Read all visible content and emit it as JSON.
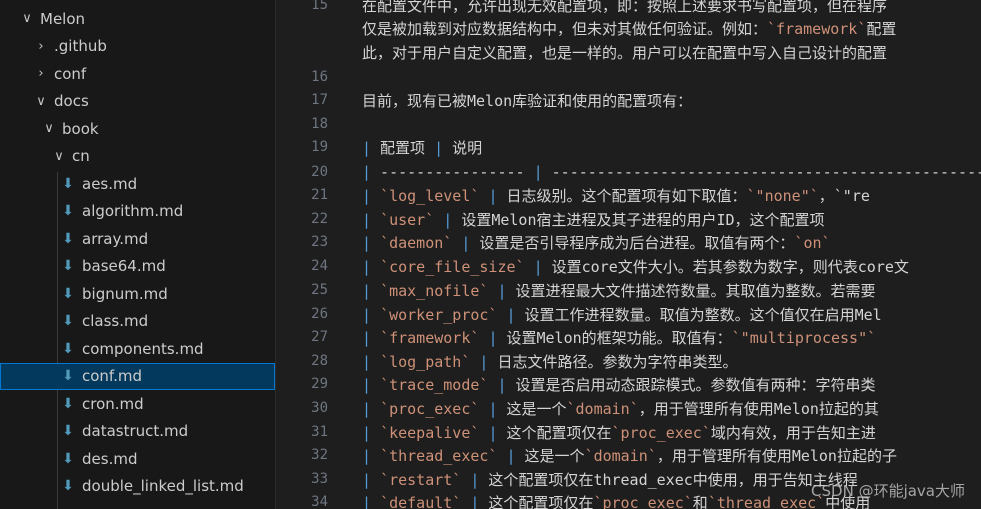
{
  "sidebar": {
    "items": [
      {
        "label": "Melon",
        "chev": "∨",
        "indent": 20
      },
      {
        "label": ".github",
        "chev": "›",
        "indent": 34
      },
      {
        "label": "conf",
        "chev": "›",
        "indent": 34
      },
      {
        "label": "docs",
        "chev": "∨",
        "indent": 34
      },
      {
        "label": "book",
        "chev": "∨",
        "indent": 42
      },
      {
        "label": "cn",
        "chev": "∨",
        "indent": 52
      }
    ],
    "files": [
      "aes.md",
      "algorithm.md",
      "array.md",
      "base64.md",
      "bignum.md",
      "class.md",
      "components.md",
      "conf.md",
      "cron.md",
      "datastruct.md",
      "des.md",
      "double_linked_list.md"
    ],
    "selected": "conf.md"
  },
  "editor": {
    "lines": [
      {
        "n": "15",
        "t": "在配置文件中，允许出现无效配置项，即：按照上述要求书写配置项，但在程序"
      },
      {
        "n": "",
        "t": "仅是被加载到对应数据结构中，但未对其做任何验证。例如：`framework`配置"
      },
      {
        "n": "",
        "t": "此，对于用户自定义配置，也是一样的。用户可以在配置中写入自己设计的配置"
      },
      {
        "n": "16",
        "t": ""
      },
      {
        "n": "17",
        "t": "目前，现有已被Melon库验证和使用的配置项有："
      },
      {
        "n": "18",
        "t": ""
      },
      {
        "n": "19",
        "t": "| 配置项            | 说明"
      },
      {
        "n": "20",
        "t": "| ---------------- | ----------------------------------------------------"
      },
      {
        "n": "21",
        "t": "| `log_level`      | 日志级别。这个配置项有如下取值：`\"none\"`，`\"re"
      },
      {
        "n": "22",
        "t": "| `user`           | 设置Melon宿主进程及其子进程的用户ID，这个配置项"
      },
      {
        "n": "23",
        "t": "| `daemon`         | 设置是否引导程序成为后台进程。取值有两个：`on`"
      },
      {
        "n": "24",
        "t": "| `core_file_size` | 设置core文件大小。若其参数为数字，则代表core文"
      },
      {
        "n": "25",
        "t": "| `max_nofile`     | 设置进程最大文件描述符数量。其取值为整数。若需要"
      },
      {
        "n": "26",
        "t": "| `worker_proc`    | 设置工作进程数量。取值为整数。这个值仅在启用Mel"
      },
      {
        "n": "27",
        "t": "| `framework`      | 设置Melon的框架功能。取值有：`\"multiprocess\"`"
      },
      {
        "n": "28",
        "t": "| `log_path`       | 日志文件路径。参数为字符串类型。"
      },
      {
        "n": "29",
        "t": "| `trace_mode`     | 设置是否启用动态跟踪模式。参数值有两种：字符串类"
      },
      {
        "n": "30",
        "t": "| `proc_exec`      | 这是一个`domain`，用于管理所有使用Melon拉起的其"
      },
      {
        "n": "31",
        "t": "| `keepalive`      | 这个配置项仅在`proc_exec`域内有效，用于告知主进"
      },
      {
        "n": "32",
        "t": "| `thread_exec`    | 这是一个`domain`，用于管理所有使用Melon拉起的子"
      },
      {
        "n": "33",
        "t": "| `restart`        | 这个配置项仅在thread_exec中使用，用于告知主线程"
      },
      {
        "n": "34",
        "t": "| `default`        | 这个配置项仅在`proc_exec`和`thread_exec`中使用"
      }
    ]
  },
  "watermark": "CSDN @环能java大师"
}
